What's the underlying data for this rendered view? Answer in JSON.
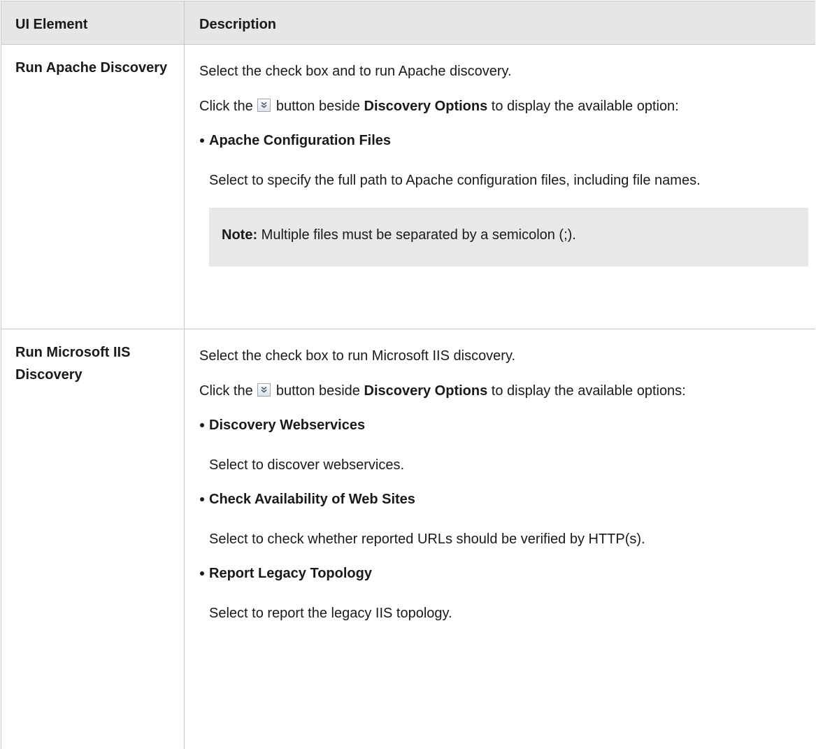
{
  "table": {
    "headers": [
      "UI Element",
      "Description"
    ],
    "rows": [
      {
        "element": "Run Apache Discovery",
        "intro": "Select the check box and to run Apache discovery.",
        "click_prefix": "Click the",
        "click_mid": "button beside",
        "click_bold": "Discovery Options",
        "click_suffix": "to display the available option:",
        "options": [
          {
            "title": "Apache Configuration Files",
            "desc": "Select to specify the full path to Apache configuration files, including file names."
          }
        ],
        "note_label": "Note:",
        "note_text": "Multiple files must be separated by a semicolon (;)."
      },
      {
        "element": "Run Microsoft IIS Discovery",
        "intro": "Select the check box to run Microsoft IIS discovery.",
        "click_prefix": "Click the",
        "click_mid": "button beside",
        "click_bold": "Discovery Options",
        "click_suffix": "to display the available options:",
        "options": [
          {
            "title": "Discovery Webservices",
            "desc": "Select to discover webservices."
          },
          {
            "title": "Check Availability of Web Sites",
            "desc": "Select to check whether reported URLs should be verified by HTTP(s)."
          },
          {
            "title": "Report Legacy Topology",
            "desc": "Select to report the legacy IIS topology."
          }
        ]
      }
    ]
  },
  "icons": {
    "expand_button_icon": "double-chevron-down-icon"
  }
}
